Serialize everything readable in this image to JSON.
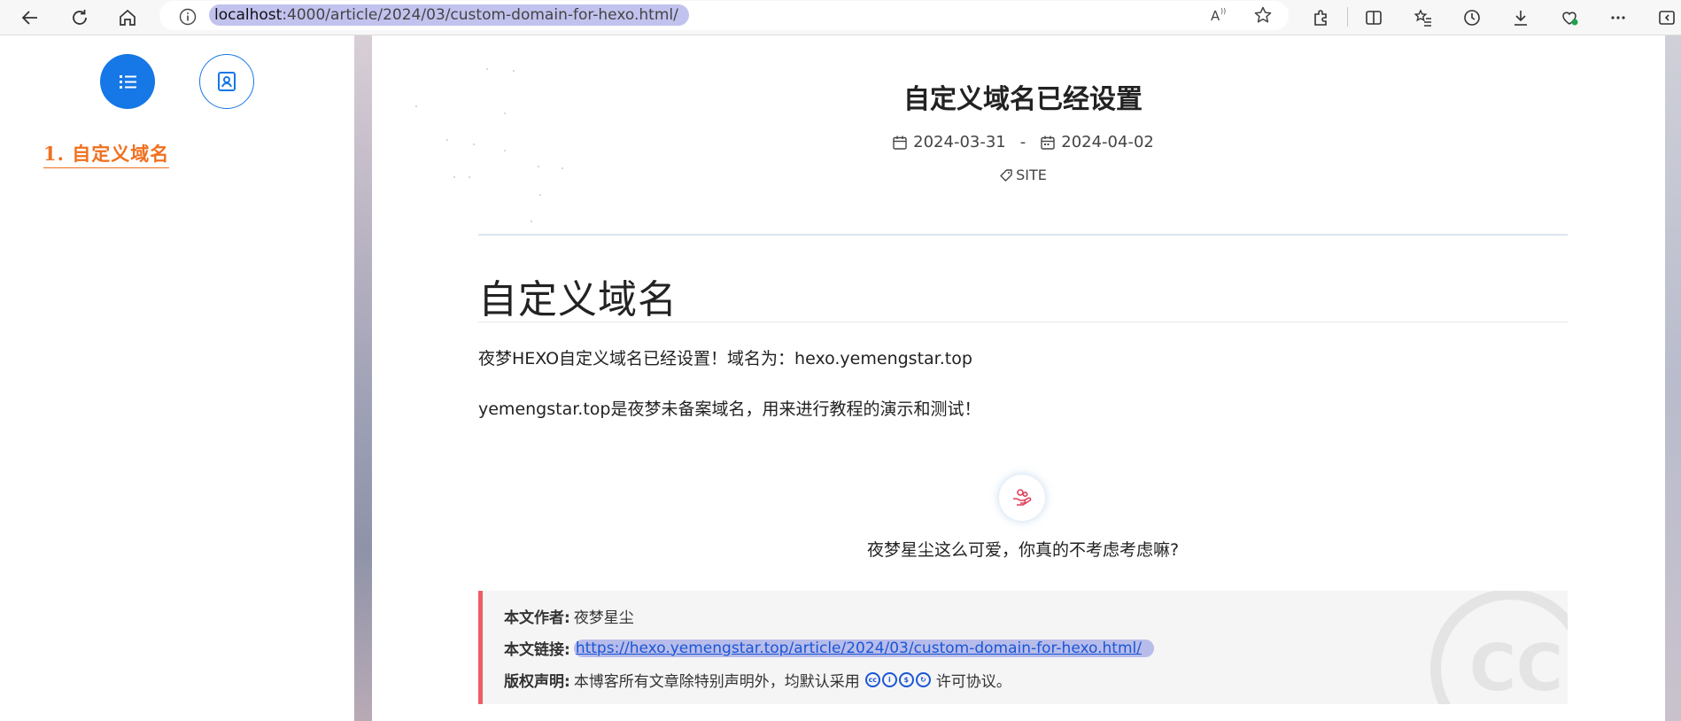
{
  "browser": {
    "url_host": "localhost",
    "url_path": ":4000/article/2024/03/custom-domain-for-hexo.html/"
  },
  "sidebar": {
    "toc_label": "1. 自定义域名"
  },
  "post": {
    "title": "自定义域名已经设置",
    "created": "2024-03-31",
    "separator": "-",
    "updated": "2024-04-02",
    "tag": "SITE"
  },
  "content": {
    "heading": "自定义域名",
    "paragraphs": [
      "夜梦HEXO自定义域名已经设置！域名为：hexo.yemengstar.top",
      "yemengstar.top是夜梦未备案域名，用来进行教程的演示和测试！"
    ]
  },
  "reward": {
    "text": "夜梦星尘这么可爱，你真的不考虑考虑嘛?"
  },
  "copyright": {
    "author_label": "本文作者:",
    "author": "夜梦星尘",
    "link_label": "本文链接:",
    "link": "https://hexo.yemengstar.top/article/2024/03/custom-domain-for-hexo.html/",
    "license_label": "版权声明:",
    "license_prefix": "本博客所有文章除特别声明外，均默认采用",
    "license_suffix": "许可协议。"
  },
  "colors": {
    "accent_blue": "#1677e6",
    "toc_orange": "#f0701f",
    "copyright_border": "#ef5d66"
  }
}
